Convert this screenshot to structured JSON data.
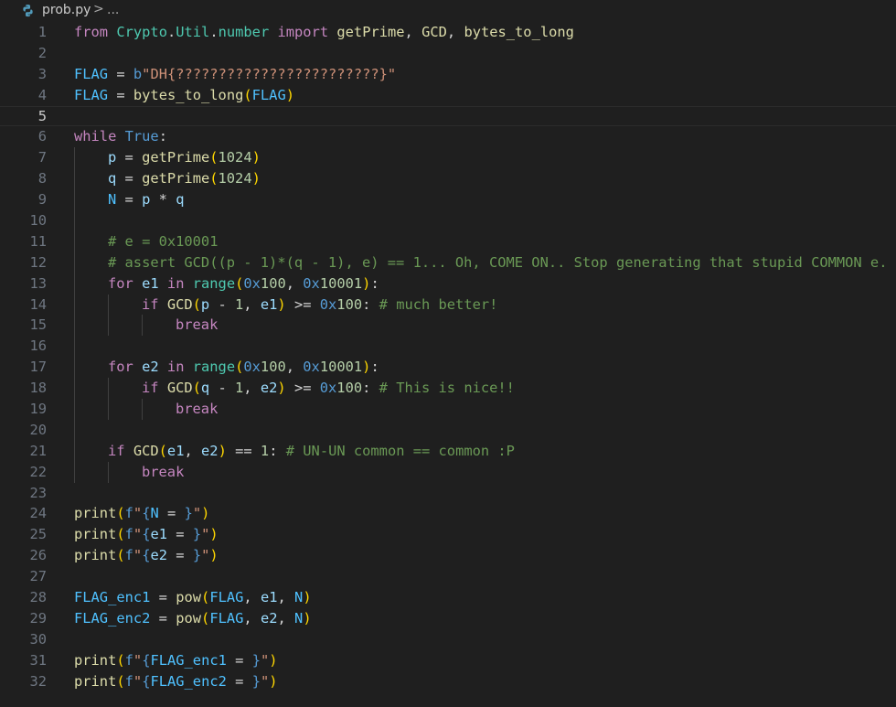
{
  "editor": {
    "breadcrumb": {
      "file_name": "prob.py",
      "separator": ">",
      "ellipsis": "..."
    },
    "current_line": 5,
    "colors": {
      "background": "#1f1f1f",
      "line_number": "#6e7681",
      "keyword_control": "#c586c0",
      "keyword": "#569cd6",
      "function": "#dcdcaa",
      "variable": "#9cdcfe",
      "constant": "#4fc1ff",
      "module": "#4ec9b0",
      "string": "#ce9178",
      "number": "#b5cea8",
      "comment": "#6a9955",
      "bracket_1": "#ffd700",
      "bracket_2": "#da70d6",
      "bracket_3": "#179fff"
    },
    "lines": [
      {
        "n": "1",
        "indent": 0,
        "tokens": [
          [
            "kw",
            "from"
          ],
          [
            "op",
            " "
          ],
          [
            "cls",
            "Crypto"
          ],
          [
            "op",
            "."
          ],
          [
            "cls",
            "Util"
          ],
          [
            "op",
            "."
          ],
          [
            "cls",
            "number"
          ],
          [
            "op",
            " "
          ],
          [
            "kw",
            "import"
          ],
          [
            "op",
            " "
          ],
          [
            "fn",
            "getPrime"
          ],
          [
            "op",
            ", "
          ],
          [
            "fn",
            "GCD"
          ],
          [
            "op",
            ", "
          ],
          [
            "fn",
            "bytes_to_long"
          ]
        ]
      },
      {
        "n": "2",
        "indent": 0,
        "tokens": []
      },
      {
        "n": "3",
        "indent": 0,
        "tokens": [
          [
            "cn",
            "FLAG"
          ],
          [
            "op",
            " = "
          ],
          [
            "kb",
            "b"
          ],
          [
            "st",
            "\"DH{????????????????????????}\""
          ]
        ]
      },
      {
        "n": "4",
        "indent": 0,
        "tokens": [
          [
            "cn",
            "FLAG"
          ],
          [
            "op",
            " = "
          ],
          [
            "fn",
            "bytes_to_long"
          ],
          [
            "b1",
            "("
          ],
          [
            "cn",
            "FLAG"
          ],
          [
            "b1",
            ")"
          ]
        ]
      },
      {
        "n": "5",
        "indent": 0,
        "tokens": []
      },
      {
        "n": "6",
        "indent": 0,
        "tokens": [
          [
            "kw",
            "while"
          ],
          [
            "op",
            " "
          ],
          [
            "kb",
            "True"
          ],
          [
            "op",
            ":"
          ]
        ]
      },
      {
        "n": "7",
        "indent": 1,
        "tokens": [
          [
            "vr",
            "p"
          ],
          [
            "op",
            " = "
          ],
          [
            "fn",
            "getPrime"
          ],
          [
            "b1",
            "("
          ],
          [
            "nm",
            "1024"
          ],
          [
            "b1",
            ")"
          ]
        ]
      },
      {
        "n": "8",
        "indent": 1,
        "tokens": [
          [
            "vr",
            "q"
          ],
          [
            "op",
            " = "
          ],
          [
            "fn",
            "getPrime"
          ],
          [
            "b1",
            "("
          ],
          [
            "nm",
            "1024"
          ],
          [
            "b1",
            ")"
          ]
        ]
      },
      {
        "n": "9",
        "indent": 1,
        "tokens": [
          [
            "cn",
            "N"
          ],
          [
            "op",
            " = "
          ],
          [
            "vr",
            "p"
          ],
          [
            "op",
            " * "
          ],
          [
            "vr",
            "q"
          ]
        ]
      },
      {
        "n": "10",
        "indent": 1,
        "tokens": []
      },
      {
        "n": "11",
        "indent": 1,
        "tokens": [
          [
            "cm",
            "# e = 0x10001"
          ]
        ]
      },
      {
        "n": "12",
        "indent": 1,
        "tokens": [
          [
            "cm",
            "# assert GCD((p - 1)*(q - 1), e) == 1... Oh, COME ON.. Stop generating that stupid COMMON e."
          ]
        ]
      },
      {
        "n": "13",
        "indent": 1,
        "tokens": [
          [
            "kw",
            "for"
          ],
          [
            "op",
            " "
          ],
          [
            "vr",
            "e1"
          ],
          [
            "op",
            " "
          ],
          [
            "kw",
            "in"
          ],
          [
            "op",
            " "
          ],
          [
            "cls",
            "range"
          ],
          [
            "b1",
            "("
          ],
          [
            "kb",
            "0x"
          ],
          [
            "nm",
            "100"
          ],
          [
            "op",
            ", "
          ],
          [
            "kb",
            "0x"
          ],
          [
            "nm",
            "10001"
          ],
          [
            "b1",
            ")"
          ],
          [
            "op",
            ":"
          ]
        ]
      },
      {
        "n": "14",
        "indent": 2,
        "tokens": [
          [
            "kw",
            "if"
          ],
          [
            "op",
            " "
          ],
          [
            "fn",
            "GCD"
          ],
          [
            "b1",
            "("
          ],
          [
            "vr",
            "p"
          ],
          [
            "op",
            " - "
          ],
          [
            "nm",
            "1"
          ],
          [
            "op",
            ", "
          ],
          [
            "vr",
            "e1"
          ],
          [
            "b1",
            ")"
          ],
          [
            "op",
            " >= "
          ],
          [
            "kb",
            "0x"
          ],
          [
            "nm",
            "100"
          ],
          [
            "op",
            ": "
          ],
          [
            "cm",
            "# much better!"
          ]
        ]
      },
      {
        "n": "15",
        "indent": 3,
        "tokens": [
          [
            "kw",
            "break"
          ]
        ]
      },
      {
        "n": "16",
        "indent": 1,
        "tokens": []
      },
      {
        "n": "17",
        "indent": 1,
        "tokens": [
          [
            "kw",
            "for"
          ],
          [
            "op",
            " "
          ],
          [
            "vr",
            "e2"
          ],
          [
            "op",
            " "
          ],
          [
            "kw",
            "in"
          ],
          [
            "op",
            " "
          ],
          [
            "cls",
            "range"
          ],
          [
            "b1",
            "("
          ],
          [
            "kb",
            "0x"
          ],
          [
            "nm",
            "100"
          ],
          [
            "op",
            ", "
          ],
          [
            "kb",
            "0x"
          ],
          [
            "nm",
            "10001"
          ],
          [
            "b1",
            ")"
          ],
          [
            "op",
            ":"
          ]
        ]
      },
      {
        "n": "18",
        "indent": 2,
        "tokens": [
          [
            "kw",
            "if"
          ],
          [
            "op",
            " "
          ],
          [
            "fn",
            "GCD"
          ],
          [
            "b1",
            "("
          ],
          [
            "vr",
            "q"
          ],
          [
            "op",
            " - "
          ],
          [
            "nm",
            "1"
          ],
          [
            "op",
            ", "
          ],
          [
            "vr",
            "e2"
          ],
          [
            "b1",
            ")"
          ],
          [
            "op",
            " >= "
          ],
          [
            "kb",
            "0x"
          ],
          [
            "nm",
            "100"
          ],
          [
            "op",
            ": "
          ],
          [
            "cm",
            "# This is nice!!"
          ]
        ]
      },
      {
        "n": "19",
        "indent": 3,
        "tokens": [
          [
            "kw",
            "break"
          ]
        ]
      },
      {
        "n": "20",
        "indent": 1,
        "tokens": []
      },
      {
        "n": "21",
        "indent": 1,
        "tokens": [
          [
            "kw",
            "if"
          ],
          [
            "op",
            " "
          ],
          [
            "fn",
            "GCD"
          ],
          [
            "b1",
            "("
          ],
          [
            "vr",
            "e1"
          ],
          [
            "op",
            ", "
          ],
          [
            "vr",
            "e2"
          ],
          [
            "b1",
            ")"
          ],
          [
            "op",
            " == "
          ],
          [
            "nm",
            "1"
          ],
          [
            "op",
            ": "
          ],
          [
            "cm",
            "# UN-UN common == common :P"
          ]
        ]
      },
      {
        "n": "22",
        "indent": 2,
        "tokens": [
          [
            "kw",
            "break"
          ]
        ]
      },
      {
        "n": "23",
        "indent": 0,
        "tokens": []
      },
      {
        "n": "24",
        "indent": 0,
        "tokens": [
          [
            "fn",
            "print"
          ],
          [
            "b1",
            "("
          ],
          [
            "kb",
            "f"
          ],
          [
            "st",
            "\""
          ],
          [
            "kb",
            "{"
          ],
          [
            "cn",
            "N"
          ],
          [
            "op",
            " = "
          ],
          [
            "kb",
            "}"
          ],
          [
            "st",
            "\""
          ],
          [
            "b1",
            ")"
          ]
        ]
      },
      {
        "n": "25",
        "indent": 0,
        "tokens": [
          [
            "fn",
            "print"
          ],
          [
            "b1",
            "("
          ],
          [
            "kb",
            "f"
          ],
          [
            "st",
            "\""
          ],
          [
            "kb",
            "{"
          ],
          [
            "vr",
            "e1"
          ],
          [
            "op",
            " = "
          ],
          [
            "kb",
            "}"
          ],
          [
            "st",
            "\""
          ],
          [
            "b1",
            ")"
          ]
        ]
      },
      {
        "n": "26",
        "indent": 0,
        "tokens": [
          [
            "fn",
            "print"
          ],
          [
            "b1",
            "("
          ],
          [
            "kb",
            "f"
          ],
          [
            "st",
            "\""
          ],
          [
            "kb",
            "{"
          ],
          [
            "vr",
            "e2"
          ],
          [
            "op",
            " = "
          ],
          [
            "kb",
            "}"
          ],
          [
            "st",
            "\""
          ],
          [
            "b1",
            ")"
          ]
        ]
      },
      {
        "n": "27",
        "indent": 0,
        "tokens": []
      },
      {
        "n": "28",
        "indent": 0,
        "tokens": [
          [
            "cn",
            "FLAG_enc1"
          ],
          [
            "op",
            " = "
          ],
          [
            "fn",
            "pow"
          ],
          [
            "b1",
            "("
          ],
          [
            "cn",
            "FLAG"
          ],
          [
            "op",
            ", "
          ],
          [
            "vr",
            "e1"
          ],
          [
            "op",
            ", "
          ],
          [
            "cn",
            "N"
          ],
          [
            "b1",
            ")"
          ]
        ]
      },
      {
        "n": "29",
        "indent": 0,
        "tokens": [
          [
            "cn",
            "FLAG_enc2"
          ],
          [
            "op",
            " = "
          ],
          [
            "fn",
            "pow"
          ],
          [
            "b1",
            "("
          ],
          [
            "cn",
            "FLAG"
          ],
          [
            "op",
            ", "
          ],
          [
            "vr",
            "e2"
          ],
          [
            "op",
            ", "
          ],
          [
            "cn",
            "N"
          ],
          [
            "b1",
            ")"
          ]
        ]
      },
      {
        "n": "30",
        "indent": 0,
        "tokens": []
      },
      {
        "n": "31",
        "indent": 0,
        "tokens": [
          [
            "fn",
            "print"
          ],
          [
            "b1",
            "("
          ],
          [
            "kb",
            "f"
          ],
          [
            "st",
            "\""
          ],
          [
            "kb",
            "{"
          ],
          [
            "cn",
            "FLAG_enc1"
          ],
          [
            "op",
            " = "
          ],
          [
            "kb",
            "}"
          ],
          [
            "st",
            "\""
          ],
          [
            "b1",
            ")"
          ]
        ]
      },
      {
        "n": "32",
        "indent": 0,
        "tokens": [
          [
            "fn",
            "print"
          ],
          [
            "b1",
            "("
          ],
          [
            "kb",
            "f"
          ],
          [
            "st",
            "\""
          ],
          [
            "kb",
            "{"
          ],
          [
            "cn",
            "FLAG_enc2"
          ],
          [
            "op",
            " = "
          ],
          [
            "kb",
            "}"
          ],
          [
            "st",
            "\""
          ],
          [
            "b1",
            ")"
          ]
        ]
      }
    ]
  }
}
